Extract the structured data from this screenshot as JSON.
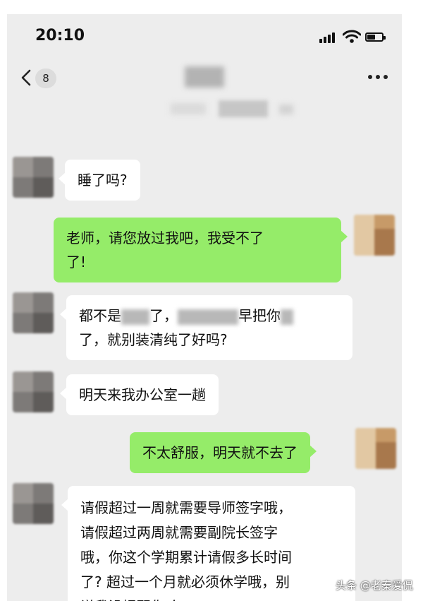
{
  "status_bar": {
    "time": "20:10"
  },
  "nav": {
    "unread_badge": "8"
  },
  "messages": [
    {
      "direction": "incoming",
      "lines": [
        "睡了吗?"
      ]
    },
    {
      "direction": "outgoing",
      "lines": [
        "老师，请您放过我吧，我受不了",
        "了!"
      ]
    },
    {
      "direction": "incoming",
      "parts": [
        "都不是",
        "了，",
        "早把你",
        "了，就别装清纯了好吗?"
      ]
    },
    {
      "direction": "incoming",
      "lines": [
        "明天来我办公室一趟"
      ]
    },
    {
      "direction": "outgoing",
      "lines": [
        "不太舒服，明天就不去了"
      ]
    },
    {
      "direction": "incoming",
      "lines": [
        "请假超过一周就需要导师签字哦，",
        "请假超过两周就需要副院长签字",
        "哦，你这个学期累计请假多长时间",
        "了? 超过一个月就必须休学哦，别",
        "说我没提醒你哈"
      ]
    }
  ],
  "watermark": "头条 @老秦爱侃",
  "colors": {
    "chat_background": "#ededed",
    "outgoing_bubble": "#95ec69",
    "incoming_bubble": "#ffffff"
  }
}
